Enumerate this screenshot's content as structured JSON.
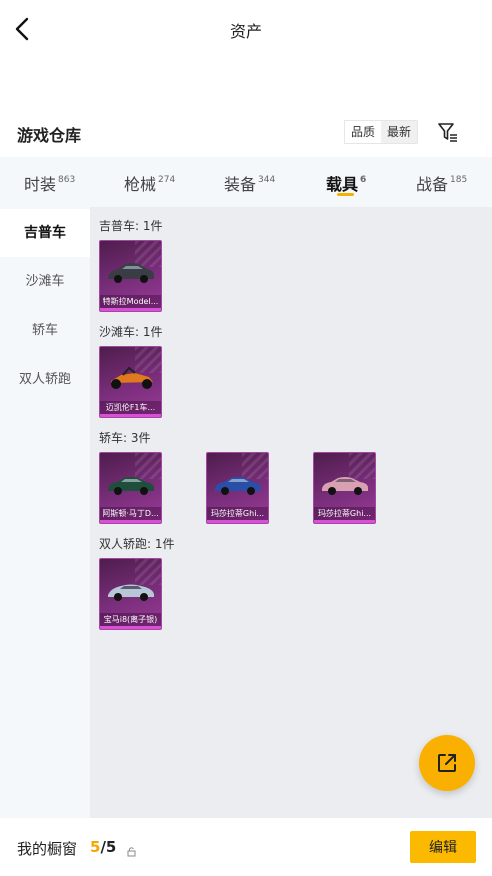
{
  "header": {
    "title": "资产"
  },
  "section": {
    "title": "游戏仓库",
    "sort_options": [
      "品质",
      "最新"
    ]
  },
  "tabs": [
    {
      "label": "时装",
      "count": "863"
    },
    {
      "label": "枪械",
      "count": "274"
    },
    {
      "label": "装备",
      "count": "344"
    },
    {
      "label": "载具",
      "count": "6"
    },
    {
      "label": "战备",
      "count": "185"
    }
  ],
  "active_tab": "载具",
  "sidebar": {
    "items": [
      "吉普车",
      "沙滩车",
      "轿车",
      "双人轿跑"
    ]
  },
  "groups": [
    {
      "label": "吉普车: 1件",
      "items": [
        {
          "name": "特斯拉Model...",
          "color": "#3a3d44"
        }
      ]
    },
    {
      "label": "沙滩车: 1件",
      "items": [
        {
          "name": "迈凯伦F1车...",
          "color": "#e07a1c"
        }
      ]
    },
    {
      "label": "轿车: 3件",
      "items": [
        {
          "name": "阿斯顿·马丁D...",
          "color": "#1f4f3c"
        },
        {
          "name": "玛莎拉蒂Ghi...",
          "color": "#2a4fa8"
        },
        {
          "name": "玛莎拉蒂Ghi...",
          "color": "#d9a0b4"
        }
      ]
    },
    {
      "label": "双人轿跑: 1件",
      "items": [
        {
          "name": "宝马i8(离子银)",
          "color": "#b9c6d8"
        }
      ]
    }
  ],
  "bottom": {
    "window_label": "我的橱窗",
    "count_current": "5",
    "count_total": "/5",
    "edit_label": "编辑"
  },
  "colors": {
    "accent": "#f9b000",
    "card_purple": "#7a2e7b",
    "sidebar_bg": "#f4f8fb",
    "content_bg": "#ebedf1"
  }
}
